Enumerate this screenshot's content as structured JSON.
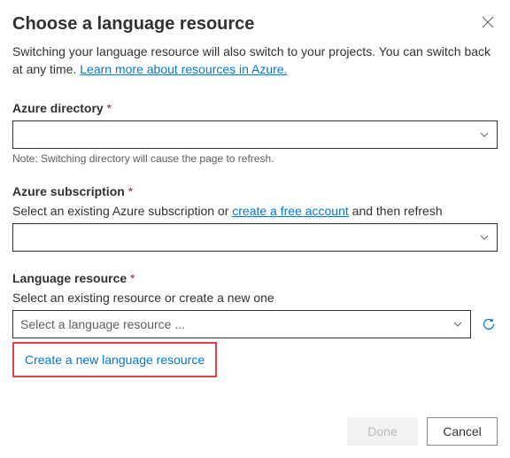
{
  "header": {
    "title": "Choose a language resource"
  },
  "description": {
    "text_before": "Switching your language resource will also switch to your projects. You can switch back at any time. ",
    "link": "Learn more about resources in Azure."
  },
  "fields": {
    "directory": {
      "label": "Azure directory",
      "required_mark": "*",
      "note": "Note: Switching directory will cause the page to refresh."
    },
    "subscription": {
      "label": "Azure subscription",
      "required_mark": "*",
      "helper_before": "Select an existing Azure subscription or ",
      "helper_link": "create a free account",
      "helper_after": " and then refresh"
    },
    "resource": {
      "label": "Language resource",
      "required_mark": "*",
      "helper": "Select an existing resource or create a new one",
      "placeholder": "Select a language resource ...",
      "create_link": "Create a new language resource"
    }
  },
  "footer": {
    "done": "Done",
    "cancel": "Cancel"
  },
  "colors": {
    "link": "#0078d4",
    "highlight": "#e3404a"
  }
}
